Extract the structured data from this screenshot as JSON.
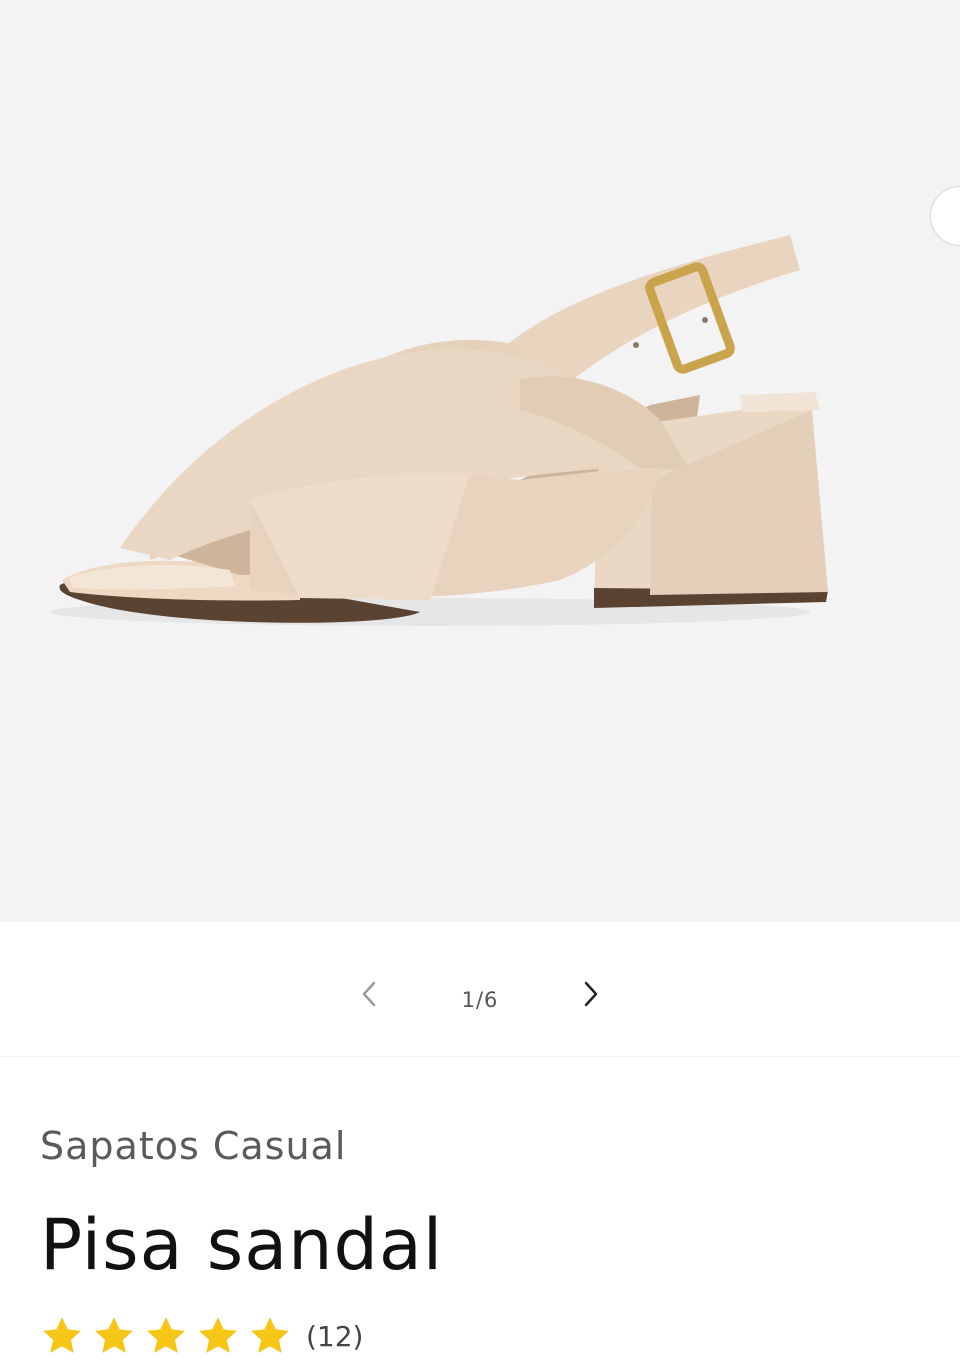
{
  "gallery": {
    "image_alt": "Pisa sandal",
    "counter_current": "1",
    "counter_separator": "/",
    "counter_total": "6",
    "prev_label": "‹",
    "next_label": "›"
  },
  "product": {
    "vendor": "Sapatos Casual",
    "title": "Pisa sandal",
    "rating": 5,
    "rating_max": 5,
    "review_count": "(12)"
  },
  "colors": {
    "star": "#f5c518",
    "gallery_bg": "#f3f3f3",
    "text_primary": "#111111",
    "text_secondary": "#5a5a5a"
  },
  "icons": {
    "prev": "chevron-left-icon",
    "next": "chevron-right-icon",
    "rating": "star-icon"
  }
}
